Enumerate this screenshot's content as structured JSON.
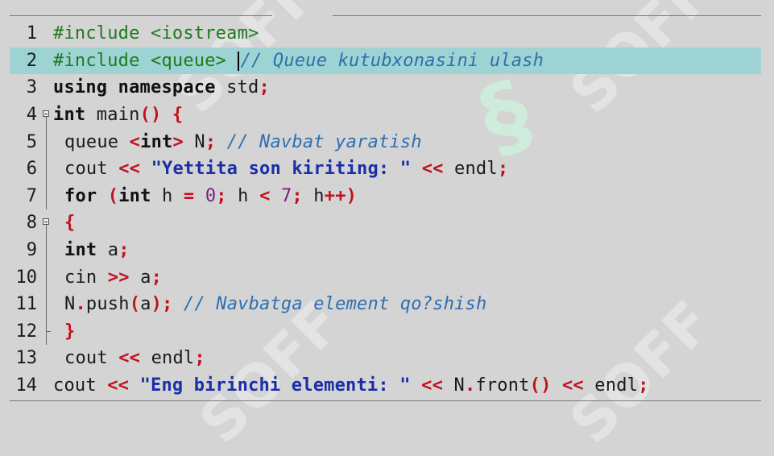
{
  "watermark": {
    "text": "SOFF"
  },
  "editor": {
    "current_line": 2,
    "lines": [
      {
        "n": "1",
        "fold": "",
        "indent": 0,
        "tokens": [
          {
            "c": "pre",
            "t": "#include <iostream>"
          }
        ]
      },
      {
        "n": "2",
        "fold": "",
        "indent": 0,
        "tokens": [
          {
            "c": "pre",
            "t": "#include <queue> "
          },
          {
            "c": "caret",
            "t": ""
          },
          {
            "c": "cmt",
            "t": "// Queue kutubxonasini ulash"
          }
        ]
      },
      {
        "n": "3",
        "fold": "",
        "indent": 0,
        "tokens": [
          {
            "c": "kw",
            "t": "using namespace"
          },
          {
            "c": "id",
            "t": " std"
          },
          {
            "c": "op",
            "t": ";"
          }
        ]
      },
      {
        "n": "4",
        "fold": "box",
        "indent": 0,
        "tokens": [
          {
            "c": "kw",
            "t": "int"
          },
          {
            "c": "id",
            "t": " main"
          },
          {
            "c": "op",
            "t": "() {"
          }
        ]
      },
      {
        "n": "5",
        "fold": "line",
        "indent": 1,
        "tokens": [
          {
            "c": "id",
            "t": "queue "
          },
          {
            "c": "op",
            "t": "<"
          },
          {
            "c": "kw",
            "t": "int"
          },
          {
            "c": "op",
            "t": ">"
          },
          {
            "c": "id",
            "t": " N"
          },
          {
            "c": "op",
            "t": ";"
          },
          {
            "c": "cmt",
            "t": " // Navbat yaratish"
          }
        ]
      },
      {
        "n": "6",
        "fold": "line",
        "indent": 1,
        "tokens": [
          {
            "c": "id",
            "t": "cout "
          },
          {
            "c": "op",
            "t": "<<"
          },
          {
            "c": "str",
            "t": " \"Yettita son kiriting: \" "
          },
          {
            "c": "op",
            "t": "<<"
          },
          {
            "c": "id",
            "t": " endl"
          },
          {
            "c": "op",
            "t": ";"
          }
        ]
      },
      {
        "n": "7",
        "fold": "line",
        "indent": 1,
        "tokens": [
          {
            "c": "kw",
            "t": "for"
          },
          {
            "c": "op",
            "t": " ("
          },
          {
            "c": "kw",
            "t": "int"
          },
          {
            "c": "id",
            "t": " h "
          },
          {
            "c": "op",
            "t": "="
          },
          {
            "c": "num",
            "t": " 0"
          },
          {
            "c": "op",
            "t": ";"
          },
          {
            "c": "id",
            "t": " h "
          },
          {
            "c": "op",
            "t": "<"
          },
          {
            "c": "num",
            "t": " 7"
          },
          {
            "c": "op",
            "t": ";"
          },
          {
            "c": "id",
            "t": " h"
          },
          {
            "c": "op",
            "t": "++)"
          }
        ]
      },
      {
        "n": "8",
        "fold": "box",
        "indent": 1,
        "tokens": [
          {
            "c": "op",
            "t": "{"
          }
        ]
      },
      {
        "n": "9",
        "fold": "line",
        "indent": 1,
        "tokens": [
          {
            "c": "kw",
            "t": "int"
          },
          {
            "c": "id",
            "t": " a"
          },
          {
            "c": "op",
            "t": ";"
          }
        ]
      },
      {
        "n": "10",
        "fold": "line",
        "indent": 1,
        "tokens": [
          {
            "c": "id",
            "t": "cin "
          },
          {
            "c": "op",
            "t": ">>"
          },
          {
            "c": "id",
            "t": " a"
          },
          {
            "c": "op",
            "t": ";"
          }
        ]
      },
      {
        "n": "11",
        "fold": "line",
        "indent": 1,
        "tokens": [
          {
            "c": "id",
            "t": "N"
          },
          {
            "c": "op",
            "t": "."
          },
          {
            "c": "id",
            "t": "push"
          },
          {
            "c": "op",
            "t": "("
          },
          {
            "c": "id",
            "t": "a"
          },
          {
            "c": "op",
            "t": ");"
          },
          {
            "c": "cmt",
            "t": " // Navbatga element qo?shish"
          }
        ]
      },
      {
        "n": "12",
        "fold": "end",
        "indent": 1,
        "tokens": [
          {
            "c": "op",
            "t": "}"
          }
        ]
      },
      {
        "n": "13",
        "fold": "line",
        "indent": 1,
        "tokens": [
          {
            "c": "id",
            "t": "cout "
          },
          {
            "c": "op",
            "t": "<<"
          },
          {
            "c": "id",
            "t": " endl"
          },
          {
            "c": "op",
            "t": ";"
          }
        ]
      },
      {
        "n": "14",
        "fold": "line",
        "indent": 0,
        "tokens": [
          {
            "c": "id",
            "t": "cout "
          },
          {
            "c": "op",
            "t": "<<"
          },
          {
            "c": "str",
            "t": " \"Eng birinchi elementi: \" "
          },
          {
            "c": "op",
            "t": "<<"
          },
          {
            "c": "id",
            "t": " N"
          },
          {
            "c": "op",
            "t": "."
          },
          {
            "c": "id",
            "t": "front"
          },
          {
            "c": "op",
            "t": "()"
          },
          {
            "c": "id",
            "t": " "
          },
          {
            "c": "op",
            "t": "<<"
          },
          {
            "c": "id",
            "t": " endl"
          },
          {
            "c": "op",
            "t": ";"
          }
        ]
      }
    ]
  },
  "colors": {
    "background": "#d4d4d4",
    "current_line": "#9ed3d3",
    "preprocessor": "#1e7a1e",
    "operator": "#c0121e",
    "string": "#1a2ea8",
    "number": "#7a1f7a",
    "comment": "#2e6fb0"
  }
}
